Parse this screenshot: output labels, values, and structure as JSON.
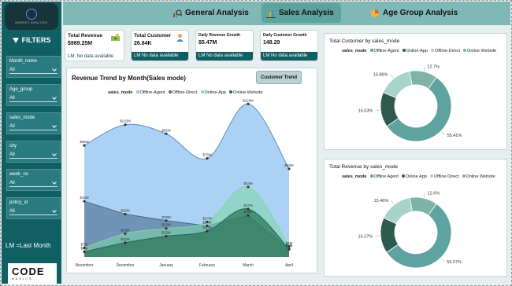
{
  "sidebar": {
    "logo_text": "MARKET ANALYSIS",
    "filters_title": "FILTERS",
    "filters": [
      {
        "label": "Month_name",
        "value": "All"
      },
      {
        "label": "Age_group",
        "value": "All"
      },
      {
        "label": "sales_mode",
        "value": "All"
      },
      {
        "label": "city",
        "value": "All"
      },
      {
        "label": "week_no",
        "value": "All"
      },
      {
        "label": "policy_id",
        "value": "All"
      }
    ],
    "lm_note": "LM =Last Month",
    "brand_main": "CODE",
    "brand_sub": "BASICS"
  },
  "nav": {
    "tabs": [
      {
        "label": "General Analysis",
        "active": false
      },
      {
        "label": "Sales Analysis",
        "active": true
      },
      {
        "label": "Age Group Analysis",
        "active": false
      }
    ]
  },
  "kpis": [
    {
      "title": "Total Revenue",
      "value": "$989.25M",
      "lm": "LM: No data available"
    },
    {
      "title": "Total Customer",
      "value": "26.84K",
      "lm": "LM No data available"
    },
    {
      "title": "Daily Revenue Growth",
      "value": "$5.47M",
      "lm": "LM No data available"
    },
    {
      "title": "Daily Customer Growth",
      "value": "148.29",
      "lm": "LM No data available"
    }
  ],
  "revenue_chart": {
    "title": "Revenue Trend by Month(Sales mode)",
    "button_label": "Customer Trend",
    "legend_title": "sales_mode"
  },
  "chart_data": [
    {
      "type": "area",
      "title": "Revenue Trend by Month(Sales mode)",
      "legend_title": "sales_mode",
      "categories": [
        "November",
        "December",
        "January",
        "February",
        "March",
        "April"
      ],
      "series": [
        {
          "name": "Offline-Agent",
          "color": "#8fc3f0",
          "values": [
            86,
            102,
            95,
            76,
            118,
            68
          ],
          "labels": [
            "$86M",
            "$102M",
            "$95M",
            "$76M",
            "$118M",
            "$68M"
          ]
        },
        {
          "name": "Offline-Direct",
          "color": "#4a6b8c",
          "values": [
            43,
            33,
            28,
            24,
            32,
            6
          ],
          "labels": [
            "$43M",
            "$33M",
            "$28M",
            "$24M",
            "$32M",
            "$6M"
          ]
        },
        {
          "name": "Online-App",
          "color": "#7fd6a8",
          "values": [
            7,
            18,
            22,
            27,
            54,
            8
          ],
          "labels": [
            "$7M",
            "$18M",
            "$22M",
            "$27M",
            "$54M",
            "$8M"
          ]
        },
        {
          "name": "Online-Website",
          "color": "#1f6b4a",
          "values": [
            4,
            11,
            16,
            20,
            37,
            6
          ],
          "labels": [
            "$4M",
            "$11M",
            "$16M",
            "$20M",
            "$37M",
            "$6M"
          ]
        }
      ]
    },
    {
      "type": "pie",
      "title": "Total Customer by sales_mode",
      "legend_title": "sales_mode",
      "slices": [
        {
          "name": "Offline-Agent",
          "value": 55.41,
          "label": "55.41%",
          "color": "#5ea39f"
        },
        {
          "name": "Online-App",
          "value": 16.03,
          "label": "16.03%",
          "color": "#2e5a4e"
        },
        {
          "name": "Offline-Direct",
          "value": 15.86,
          "label": "15.86%",
          "color": "#a7d3c8"
        },
        {
          "name": "Online Website",
          "value": 12.7,
          "label": "12.7%",
          "color": "#7fb3a8"
        }
      ]
    },
    {
      "type": "pie",
      "title": "Total Revenue by sales_mode",
      "legend_title": "sales_mode",
      "slices": [
        {
          "name": "Offline Agent",
          "value": 55.67,
          "label": "55.67%",
          "color": "#5ea39f"
        },
        {
          "name": "Online App",
          "value": 16.27,
          "label": "16.27%",
          "color": "#2e5a4e"
        },
        {
          "name": "Offline Direct",
          "value": 15.46,
          "label": "15.46%",
          "color": "#a7d3c8"
        },
        {
          "name": "Online Website",
          "value": 12.6,
          "label": "12.6%",
          "color": "#7fb3a8"
        }
      ]
    }
  ]
}
